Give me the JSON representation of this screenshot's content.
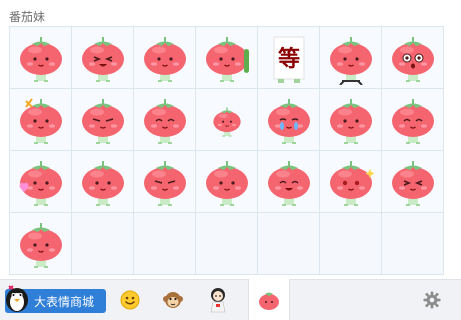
{
  "panel": {
    "title": "番茄妹"
  },
  "stickers": [
    {
      "pose": "thumbs-up"
    },
    {
      "pose": "squint-laugh"
    },
    {
      "pose": "shy-hands"
    },
    {
      "pose": "sly-with-cucumber"
    },
    {
      "pose": "sign-card"
    },
    {
      "pose": "with-stool"
    },
    {
      "pose": "shocked"
    },
    {
      "pose": "sparkle-hat"
    },
    {
      "pose": "angry-sweat"
    },
    {
      "pose": "smile-blush"
    },
    {
      "pose": "small-hug"
    },
    {
      "pose": "crying"
    },
    {
      "pose": "thinking"
    },
    {
      "pose": "calm-smile"
    },
    {
      "pose": "hug-heart"
    },
    {
      "pose": "hands-up"
    },
    {
      "pose": "meh"
    },
    {
      "pose": "neutral"
    },
    {
      "pose": "giggle"
    },
    {
      "pose": "blush-sparkle"
    },
    {
      "pose": "smirk"
    },
    {
      "pose": "standing"
    }
  ],
  "sign_card_text": "等",
  "bottombar": {
    "mall_label": "大表情商城",
    "tabs": [
      {
        "icon": "smiley-face-icon"
      },
      {
        "icon": "monkey-face-icon"
      },
      {
        "icon": "girl-sticker-icon"
      },
      {
        "icon": "tomato-sticker-icon",
        "active": true
      }
    ],
    "settings_icon": "gear-icon"
  },
  "colors": {
    "tomato": "#f4656f",
    "tomato_light": "#ff8f97",
    "leaf": "#7bc47f",
    "grid_line": "#dbe6ef",
    "accent": "#2f7ed8"
  }
}
